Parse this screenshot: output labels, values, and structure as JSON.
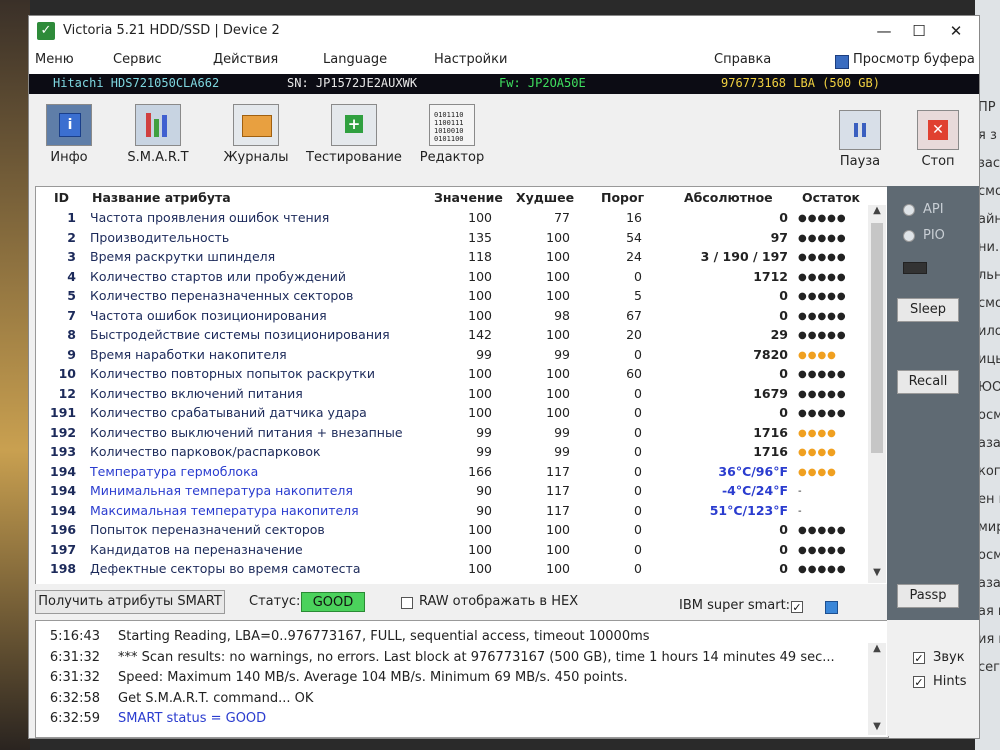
{
  "window": {
    "title": "Victoria 5.21 HDD/SSD | Device 2",
    "controls": {
      "minimize": "—",
      "maximize": "☐",
      "close": "✕"
    }
  },
  "menu": {
    "items": [
      "Меню",
      "Сервис",
      "Действия",
      "Language",
      "Настройки"
    ],
    "help": "Справка",
    "buffer": "Просмотр буфера"
  },
  "drive": {
    "model": "Hitachi HDS721050CLA662",
    "serial": "SN: JP1572JE2AUXWK",
    "firmware": "Fw: JP2OA50E",
    "capacity": "976773168 LBA (500 GB)"
  },
  "toolbar": {
    "info": "Инфо",
    "smart": "S.M.A.R.T",
    "logs": "Журналы",
    "testing": "Тестирование",
    "editor": "Редактор",
    "pause": "Пауза",
    "stop": "Стоп"
  },
  "table": {
    "columns": [
      "ID",
      "Название атрибута",
      "Значение",
      "Худшее",
      "Порог",
      "Абсолютное",
      "Остаток"
    ],
    "rows": [
      {
        "id": "1",
        "name": "Частота проявления ошибок чтения",
        "value": "100",
        "worst": "77",
        "threshold": "16",
        "raw": "0",
        "remain": "●●●●●",
        "state": "ok"
      },
      {
        "id": "2",
        "name": "Производительность",
        "value": "135",
        "worst": "100",
        "threshold": "54",
        "raw": "97",
        "remain": "●●●●●",
        "state": "ok"
      },
      {
        "id": "3",
        "name": "Время раскрутки шпинделя",
        "value": "118",
        "worst": "100",
        "threshold": "24",
        "raw": "3 / 190 / 197",
        "remain": "●●●●●",
        "state": "ok"
      },
      {
        "id": "4",
        "name": "Количество стартов или пробуждений",
        "value": "100",
        "worst": "100",
        "threshold": "0",
        "raw": "1712",
        "remain": "●●●●●",
        "state": "ok"
      },
      {
        "id": "5",
        "name": "Количество переназначенных секторов",
        "value": "100",
        "worst": "100",
        "threshold": "5",
        "raw": "0",
        "remain": "●●●●●",
        "state": "ok"
      },
      {
        "id": "7",
        "name": "Частота ошибок позиционирования",
        "value": "100",
        "worst": "98",
        "threshold": "67",
        "raw": "0",
        "remain": "●●●●●",
        "state": "ok"
      },
      {
        "id": "8",
        "name": "Быстродействие системы позиционирования",
        "value": "142",
        "worst": "100",
        "threshold": "20",
        "raw": "29",
        "remain": "●●●●●",
        "state": "ok"
      },
      {
        "id": "9",
        "name": "Время наработки накопителя",
        "value": "99",
        "worst": "99",
        "threshold": "0",
        "raw": "7820",
        "remain": "●●●●",
        "state": "warn"
      },
      {
        "id": "10",
        "name": "Количество повторных попыток раскрутки",
        "value": "100",
        "worst": "100",
        "threshold": "60",
        "raw": "0",
        "remain": "●●●●●",
        "state": "ok"
      },
      {
        "id": "12",
        "name": "Количество включений питания",
        "value": "100",
        "worst": "100",
        "threshold": "0",
        "raw": "1679",
        "remain": "●●●●●",
        "state": "ok"
      },
      {
        "id": "191",
        "name": "Количество срабатываний датчика удара",
        "value": "100",
        "worst": "100",
        "threshold": "0",
        "raw": "0",
        "remain": "●●●●●",
        "state": "ok"
      },
      {
        "id": "192",
        "name": "Количество выключений питания + внезапные",
        "value": "99",
        "worst": "99",
        "threshold": "0",
        "raw": "1716",
        "remain": "●●●●",
        "state": "warn"
      },
      {
        "id": "193",
        "name": "Количество парковок/распарковок",
        "value": "99",
        "worst": "99",
        "threshold": "0",
        "raw": "1716",
        "remain": "●●●●",
        "state": "warn"
      },
      {
        "id": "194",
        "name": "Температура гермоблока",
        "value": "166",
        "worst": "117",
        "threshold": "0",
        "raw": "36°C/96°F",
        "remain": "●●●●",
        "state": "warn",
        "blue": true
      },
      {
        "id": "194",
        "name": "Минимальная температура накопителя",
        "value": "90",
        "worst": "117",
        "threshold": "0",
        "raw": "-4°C/24°F",
        "remain": "-",
        "state": "ok",
        "blue": true
      },
      {
        "id": "194",
        "name": "Максимальная температура накопителя",
        "value": "90",
        "worst": "117",
        "threshold": "0",
        "raw": "51°C/123°F",
        "remain": "-",
        "state": "ok",
        "blue": true
      },
      {
        "id": "196",
        "name": "Попыток переназначений секторов",
        "value": "100",
        "worst": "100",
        "threshold": "0",
        "raw": "0",
        "remain": "●●●●●",
        "state": "ok"
      },
      {
        "id": "197",
        "name": "Кандидатов на переназначение",
        "value": "100",
        "worst": "100",
        "threshold": "0",
        "raw": "0",
        "remain": "●●●●●",
        "state": "ok"
      },
      {
        "id": "198",
        "name": "Дефектные секторы во время самотеста",
        "value": "100",
        "worst": "100",
        "threshold": "0",
        "raw": "0",
        "remain": "●●●●●",
        "state": "ok"
      }
    ]
  },
  "smart_bar": {
    "get_button": "Получить атрибуты SMART",
    "status_label": "Статус:",
    "status_value": "GOOD",
    "raw_hex": "RAW отображать в HEX",
    "ibm": "IBM super smart:"
  },
  "side": {
    "api": "API",
    "pio": "PIO",
    "sleep": "Sleep",
    "recall": "Recall",
    "passp": "Passp",
    "sound": "Звук",
    "hints": "Hints"
  },
  "log": [
    {
      "time": "5:16:43",
      "text": "Starting Reading, LBA=0..976773167, FULL, sequential access, timeout 10000ms",
      "blue": false
    },
    {
      "time": "6:31:32",
      "text": "*** Scan results: no warnings, no errors. Last block at 976773167 (500 GB), time 1 hours 14 minutes 49 sec...",
      "blue": false
    },
    {
      "time": "6:31:32",
      "text": "Speed: Maximum 140 MB/s. Average 104 MB/s. Minimum 69 MB/s. 450 points.",
      "blue": false
    },
    {
      "time": "6:32:58",
      "text": "Get S.M.A.R.T. command... OK",
      "blue": false
    },
    {
      "time": "6:32:59",
      "text": "SMART status = GOOD",
      "blue": true
    }
  ],
  "background_text": [
    "ПР",
    "я з",
    "зас",
    "смо",
    "айн",
    "ни. В",
    "льн",
    "смот",
    "ило.",
    "ицы.",
    "ЮО",
    "осмо",
    "азад",
    "кого",
    "ен ми",
    "мир.",
    "осмот",
    "азад",
    "ая ист",
    "ия исто",
    "сегодн"
  ],
  "colors": {
    "infobar_model": "#7fd7e0",
    "infobar_serial": "#e8e8e8",
    "infobar_fw": "#40e060",
    "infobar_capacity": "#f0d040",
    "good": "#4bd25c",
    "blue_text": "#2a3ccf",
    "warn_dots": "#f0a020"
  }
}
